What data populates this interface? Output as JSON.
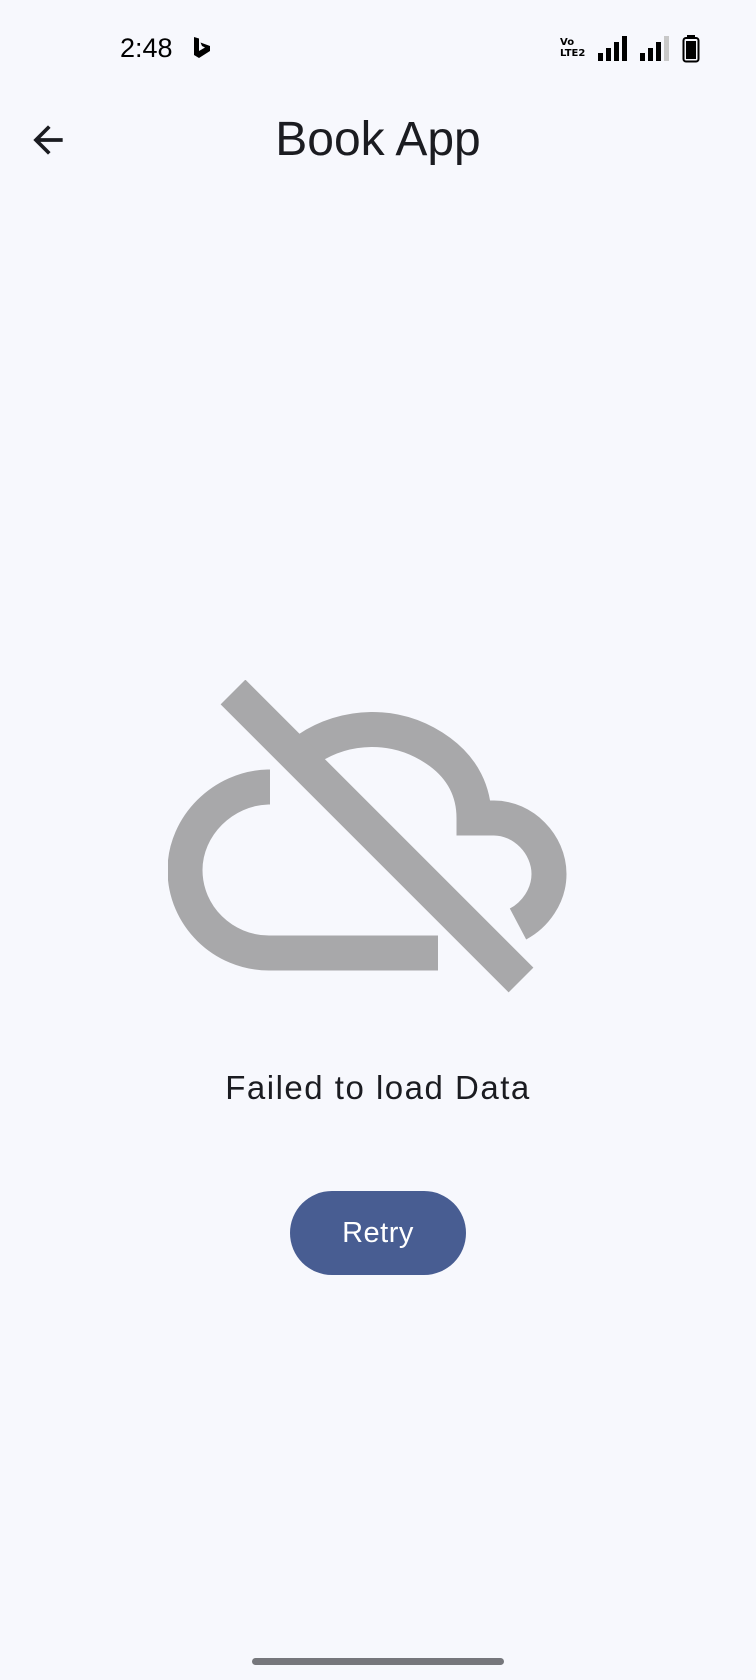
{
  "status_bar": {
    "time": "2:48",
    "volte_line1": "Vo",
    "volte_line2": "LTE2",
    "icons": [
      "bing-icon",
      "volte-icon",
      "signal-1-icon",
      "signal-2-icon",
      "battery-icon"
    ]
  },
  "app_bar": {
    "title": "Book App",
    "back_icon": "arrow-back-icon"
  },
  "content": {
    "illustration_icon": "cloud-off-icon",
    "error_message": "Failed to load Data",
    "retry_label": "Retry"
  },
  "colors": {
    "background": "#f7f8fd",
    "primary": "#485d92",
    "icon_gray": "#a8a8aa",
    "text": "#1b1c21"
  }
}
